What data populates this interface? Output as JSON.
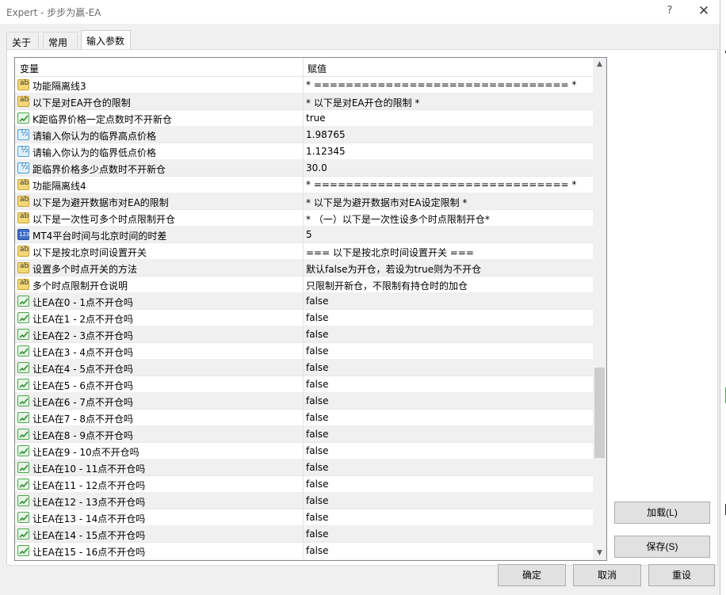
{
  "window": {
    "title": "Expert - 步步为赢-EA",
    "help": "?",
    "close": "✕"
  },
  "tabs": [
    {
      "label": "关于"
    },
    {
      "label": "常用"
    },
    {
      "label": "输入参数"
    }
  ],
  "table": {
    "col_variable": "变量",
    "col_value": "赋值",
    "rows": [
      {
        "icon": "string",
        "name": "功能隔离线3",
        "value": "* ================================ *"
      },
      {
        "icon": "string",
        "name": "以下是对EA开仓的限制",
        "value": "* 以下是对EA开仓的限制 *"
      },
      {
        "icon": "bool",
        "name": "K距临界价格一定点数时不开新仓",
        "value": "true"
      },
      {
        "icon": "double",
        "name": "请输入你认为的临界高点价格",
        "value": "1.98765"
      },
      {
        "icon": "double",
        "name": "请输入你认为的临界低点价格",
        "value": "1.12345"
      },
      {
        "icon": "double",
        "name": "距临界价格多少点数时不开新仓",
        "value": "30.0"
      },
      {
        "icon": "string",
        "name": "功能隔离线4",
        "value": "* ================================ *"
      },
      {
        "icon": "string",
        "name": "以下是为避开数据市对EA的限制",
        "value": "* 以下是为避开数据市对EA设定限制 *"
      },
      {
        "icon": "string",
        "name": "以下是一次性可多个时点限制开仓",
        "value": "* （一）以下是一次性设多个时点限制开仓*"
      },
      {
        "icon": "int",
        "name": "MT4平台时间与北京时间的时差",
        "value": "5"
      },
      {
        "icon": "string",
        "name": "以下是按北京时间设置开关",
        "value": "=== 以下是按北京时间设置开关 ==="
      },
      {
        "icon": "string",
        "name": "设置多个时点开关的方法",
        "value": "默认false为开仓，若设为true则为不开仓"
      },
      {
        "icon": "string",
        "name": "多个时点限制开仓说明",
        "value": "只限制开新仓，不限制有持仓时的加仓"
      },
      {
        "icon": "bool",
        "name": "让EA在0 - 1点不开仓吗",
        "value": "false"
      },
      {
        "icon": "bool",
        "name": "让EA在1 - 2点不开仓吗",
        "value": "false"
      },
      {
        "icon": "bool",
        "name": "让EA在2 - 3点不开仓吗",
        "value": "false"
      },
      {
        "icon": "bool",
        "name": "让EA在3 - 4点不开仓吗",
        "value": "false"
      },
      {
        "icon": "bool",
        "name": "让EA在4 - 5点不开仓吗",
        "value": "false"
      },
      {
        "icon": "bool",
        "name": "让EA在5 - 6点不开仓吗",
        "value": "false"
      },
      {
        "icon": "bool",
        "name": "让EA在6 - 7点不开仓吗",
        "value": "false"
      },
      {
        "icon": "bool",
        "name": "让EA在7 - 8点不开仓吗",
        "value": "false"
      },
      {
        "icon": "bool",
        "name": "让EA在8 - 9点不开仓吗",
        "value": "false"
      },
      {
        "icon": "bool",
        "name": "让EA在9 - 10点不开仓吗",
        "value": "false"
      },
      {
        "icon": "bool",
        "name": "让EA在10 - 11点不开仓吗",
        "value": "false"
      },
      {
        "icon": "bool",
        "name": "让EA在11 - 12点不开仓吗",
        "value": "false"
      },
      {
        "icon": "bool",
        "name": "让EA在12 - 13点不开仓吗",
        "value": "false"
      },
      {
        "icon": "bool",
        "name": "让EA在13 - 14点不开仓吗",
        "value": "false"
      },
      {
        "icon": "bool",
        "name": "让EA在14 - 15点不开仓吗",
        "value": "false"
      },
      {
        "icon": "bool",
        "name": "让EA在15 - 16点不开仓吗",
        "value": "false"
      }
    ]
  },
  "buttons": {
    "load": "加载(L)",
    "save": "保存(S)",
    "ok": "确定",
    "cancel": "取消",
    "reset": "重设"
  }
}
